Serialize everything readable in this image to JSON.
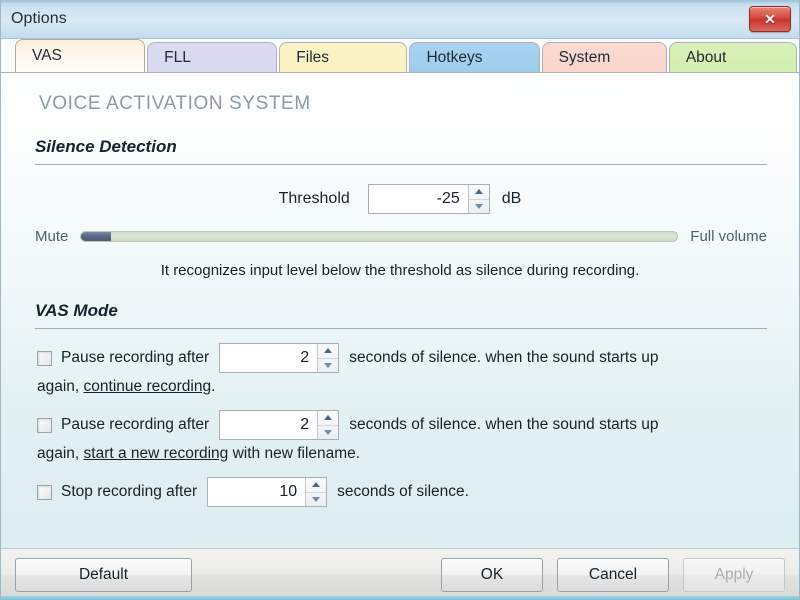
{
  "window": {
    "title": "Options",
    "close_label": "✕"
  },
  "tabs": [
    {
      "id": "vas",
      "label": "VAS",
      "active": true,
      "bg_start": "#fdf0de",
      "bg_end": "#fffdfa"
    },
    {
      "id": "fll",
      "label": "FLL",
      "active": false,
      "bg_start": "#dcdcf0",
      "bg_end": "#d7d7ee"
    },
    {
      "id": "files",
      "label": "Files",
      "active": false,
      "bg_start": "#fbf3c8",
      "bg_end": "#faf0bf"
    },
    {
      "id": "hotkeys",
      "label": "Hotkeys",
      "active": false,
      "bg_start": "#a8d3ef",
      "bg_end": "#9ecdec"
    },
    {
      "id": "system",
      "label": "System",
      "active": false,
      "bg_start": "#fbdad2",
      "bg_end": "#fad5cc"
    },
    {
      "id": "about",
      "label": "About",
      "active": false,
      "bg_start": "#d8f0b8",
      "bg_end": "#d3eeb0"
    }
  ],
  "main": {
    "page_title": "VOICE ACTIVATION SYSTEM",
    "silence": {
      "heading": "Silence Detection",
      "threshold_label": "Threshold",
      "threshold_value": "-25",
      "threshold_unit": "dB",
      "slider_min_label": "Mute",
      "slider_max_label": "Full volume",
      "slider_percent": 5,
      "hint": "It recognizes input level below the threshold as silence during recording."
    },
    "vas_mode": {
      "heading": "VAS Mode",
      "rows": [
        {
          "checked": false,
          "text_before": "Pause recording after",
          "value": "2",
          "text_after": "seconds of silence. when the sound starts up",
          "sub_before": "again,",
          "sub_link": "continue recording",
          "sub_after": "."
        },
        {
          "checked": false,
          "text_before": "Pause recording after",
          "value": "2",
          "text_after": "seconds of silence. when the sound starts up",
          "sub_before": "again,",
          "sub_link": "start a new recording",
          "sub_after": "with new filename."
        },
        {
          "checked": false,
          "text_before": "Stop recording after",
          "value": "10",
          "text_after": "seconds of silence.",
          "sub_before": "",
          "sub_link": "",
          "sub_after": ""
        }
      ]
    }
  },
  "footer": {
    "default_label": "Default",
    "ok_label": "OK",
    "cancel_label": "Cancel",
    "apply_label": "Apply",
    "apply_disabled": true
  },
  "colors": {
    "accent": "#7fc0d8",
    "titlebar": "#cfe2f0",
    "close_red": "#d9453a",
    "slider_fill": "#5b6787",
    "slider_track": "#dde6d6",
    "muted_heading": "#8d9aa2"
  }
}
